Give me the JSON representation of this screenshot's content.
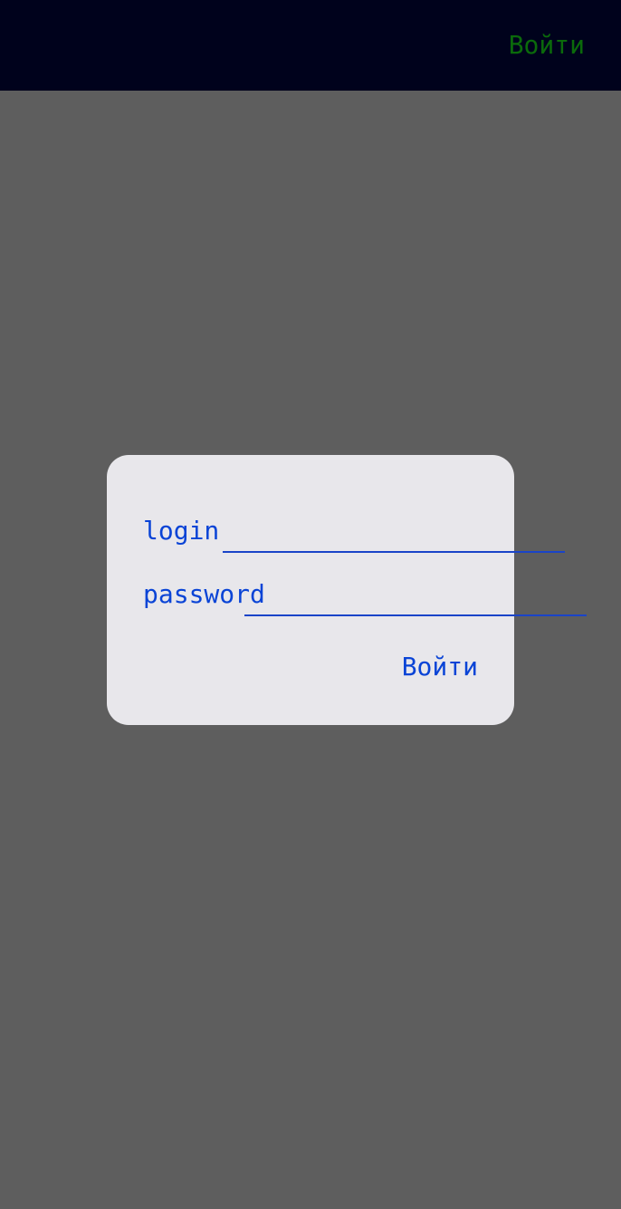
{
  "topbar": {
    "login_button": "Войти"
  },
  "dialog": {
    "login_label": "login",
    "login_value": "",
    "password_label": "password",
    "password_value": "",
    "submit_button": "Войти"
  },
  "colors": {
    "topbar_bg": "#00021c",
    "topbar_button": "#0b6a0b",
    "backdrop": "#5e5e5e",
    "dialog_bg": "#e8e7eb",
    "accent": "#0a44d6"
  }
}
